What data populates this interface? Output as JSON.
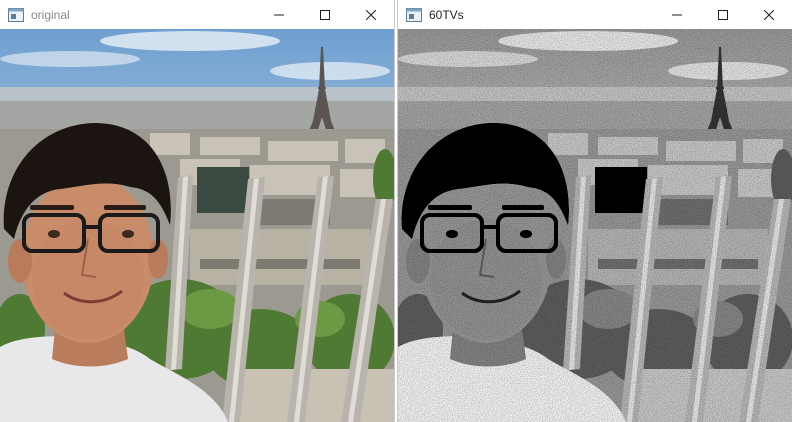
{
  "windows": [
    {
      "id": "original",
      "title": "original",
      "controls": {
        "minimize": "minimize-icon",
        "maximize": "maximize-icon",
        "close": "close-icon"
      },
      "image": {
        "kind": "color-photo",
        "subject": "selfie-with-eiffel-tower"
      }
    },
    {
      "id": "denoised",
      "title": "60TVs",
      "controls": {
        "minimize": "minimize-icon",
        "maximize": "maximize-icon",
        "close": "close-icon"
      },
      "image": {
        "kind": "grayscale-noisy-photo",
        "subject": "selfie-with-eiffel-tower"
      }
    }
  ],
  "colors": {
    "titlebar_bg": "#ffffff",
    "inactive_title_text": "#8a8a8a",
    "active_title_text": "#1f1f1f",
    "control_glyph": "#1f1f1f"
  }
}
